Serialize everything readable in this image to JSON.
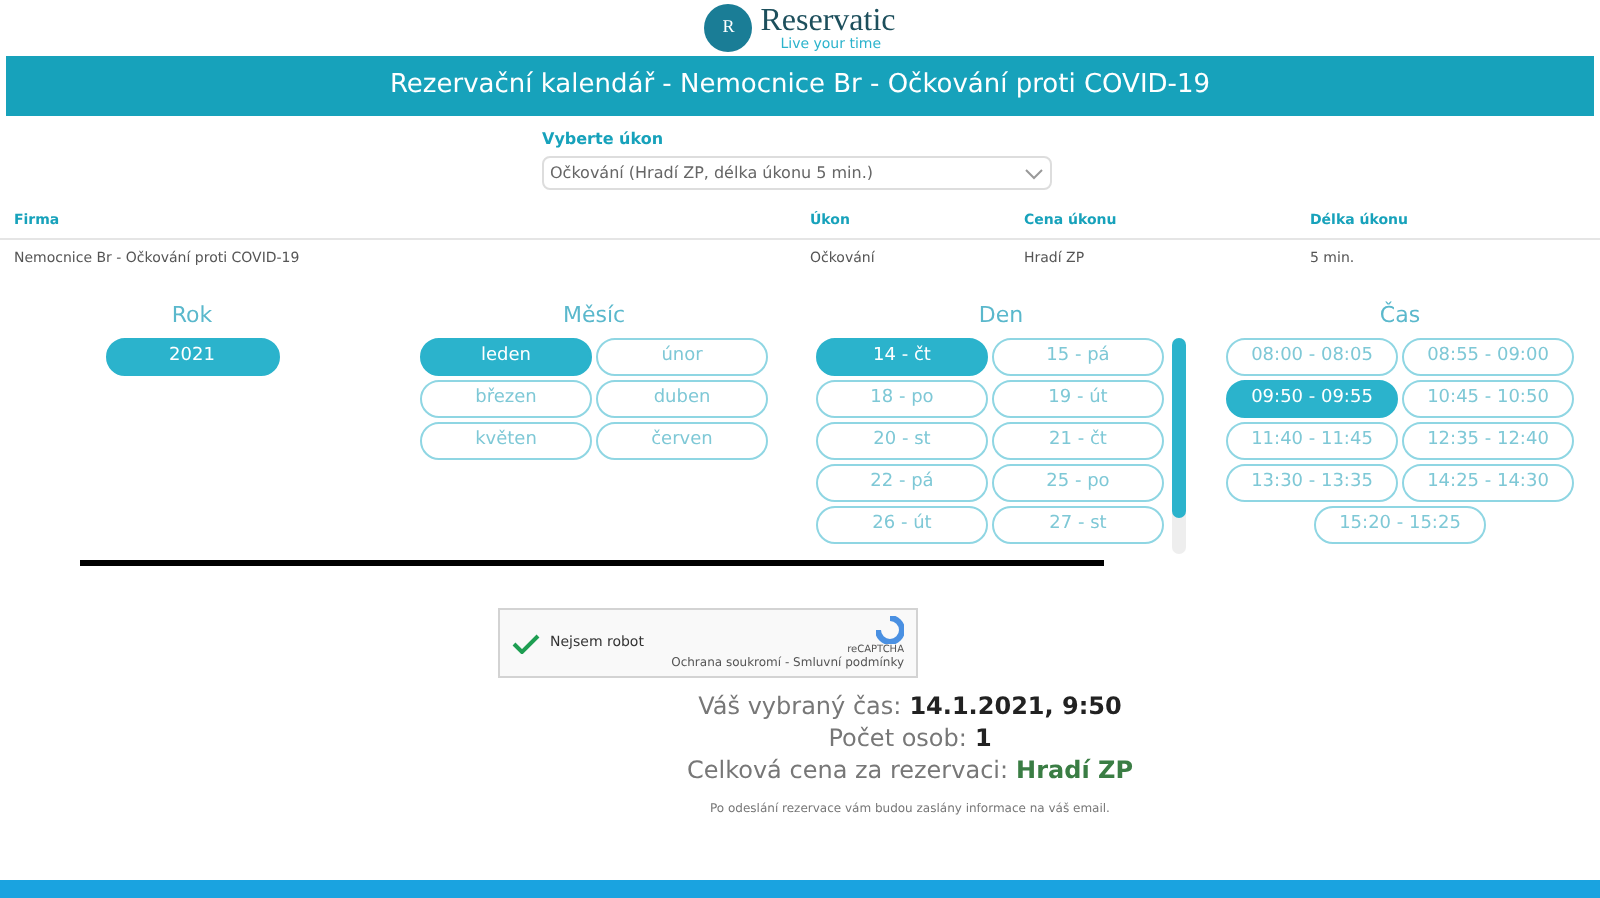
{
  "logo": {
    "name": "Reservatic",
    "tagline": "Live your time",
    "letter": "R"
  },
  "header": {
    "title": "Rezervační kalendář - Nemocnice Br - Očkování proti COVID-19"
  },
  "service_select": {
    "label": "Vyberte úkon",
    "value": "Očkování (Hradí ZP, délka úkonu 5 min.)"
  },
  "table": {
    "columns": [
      "Firma",
      "Úkon",
      "Cena úkonu",
      "Délka úkonu"
    ],
    "rows": [
      [
        "Nemocnice Br - Očkování proti COVID-19",
        "Očkování",
        "Hradí ZP",
        "5 min."
      ]
    ]
  },
  "pickers": [
    {
      "title": "Rok",
      "items": [
        {
          "label": "2021",
          "selected": true
        }
      ]
    },
    {
      "title": "Měsíc",
      "items": [
        {
          "label": "leden",
          "selected": true
        },
        {
          "label": "únor",
          "selected": false
        },
        {
          "label": "březen",
          "selected": false
        },
        {
          "label": "duben",
          "selected": false
        },
        {
          "label": "květen",
          "selected": false
        },
        {
          "label": "červen",
          "selected": false
        }
      ]
    },
    {
      "title": "Den",
      "items": [
        {
          "label": "14 - čt",
          "selected": true
        },
        {
          "label": "15 - pá",
          "selected": false
        },
        {
          "label": "18 - po",
          "selected": false
        },
        {
          "label": "19 - út",
          "selected": false
        },
        {
          "label": "20 - st",
          "selected": false
        },
        {
          "label": "21 - čt",
          "selected": false
        },
        {
          "label": "22 - pá",
          "selected": false
        },
        {
          "label": "25 - po",
          "selected": false
        },
        {
          "label": "26 - út",
          "selected": false
        },
        {
          "label": "27 - st",
          "selected": false
        }
      ]
    },
    {
      "title": "Čas",
      "items": [
        {
          "label": "08:00 - 08:05",
          "selected": false
        },
        {
          "label": "08:55 - 09:00",
          "selected": false
        },
        {
          "label": "09:50 - 09:55",
          "selected": true
        },
        {
          "label": "10:45 - 10:50",
          "selected": false
        },
        {
          "label": "11:40 - 11:45",
          "selected": false
        },
        {
          "label": "12:35 - 12:40",
          "selected": false
        },
        {
          "label": "13:30 - 13:35",
          "selected": false
        },
        {
          "label": "14:25 - 14:30",
          "selected": false
        },
        {
          "label": "15:20 - 15:25",
          "selected": false
        }
      ]
    }
  ],
  "captcha": {
    "label": "Nejsem robot",
    "checked": true,
    "brand": "reCAPTCHA",
    "links": "Ochrana soukromí - Smluvní podmínky"
  },
  "summary": [
    {
      "label": "Váš vybraný čas:",
      "value": "14.1.2021, 9:50",
      "kind": "plain"
    },
    {
      "label": "Počet osob:",
      "value": "1",
      "kind": "plain"
    },
    {
      "label": "Celková cena za rezervaci:",
      "value": "Hradí ZP",
      "kind": "price"
    }
  ],
  "note": "Po odeslání rezervace vám budou zaslány informace na váš email."
}
